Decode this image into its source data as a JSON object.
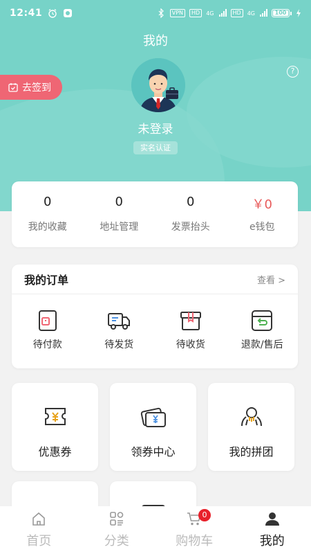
{
  "status_bar": {
    "time": "12:41",
    "vpn": "VPN",
    "hd1": "HD",
    "hd2": "HD",
    "network1": "4G",
    "network2": "4G",
    "battery": "100"
  },
  "header": {
    "title": "我的",
    "sign_in": "去签到",
    "login_status": "未登录",
    "verify": "实名认证",
    "help": "?"
  },
  "stats": [
    {
      "value": "0",
      "label": "我的收藏"
    },
    {
      "value": "0",
      "label": "地址管理"
    },
    {
      "value": "0",
      "label": "发票抬头"
    },
    {
      "value": "￥0",
      "label": "e钱包"
    }
  ],
  "orders": {
    "title": "我的订单",
    "more": "查看 >",
    "items": [
      {
        "label": "待付款",
        "icon": "wallet-icon"
      },
      {
        "label": "待发货",
        "icon": "truck-icon"
      },
      {
        "label": "待收货",
        "icon": "package-icon"
      },
      {
        "label": "退款/售后",
        "icon": "refund-icon"
      }
    ]
  },
  "tiles": [
    {
      "label": "优惠券",
      "icon": "coupon-icon"
    },
    {
      "label": "领券中心",
      "icon": "coupon-center-icon"
    },
    {
      "label": "我的拼团",
      "icon": "group-buy-icon"
    },
    {
      "label": "",
      "icon": "tile-icon"
    },
    {
      "label": "",
      "icon": "tile-icon"
    }
  ],
  "tabbar": {
    "items": [
      {
        "label": "首页",
        "icon": "home-icon"
      },
      {
        "label": "分类",
        "icon": "category-icon"
      },
      {
        "label": "购物车",
        "icon": "cart-icon"
      },
      {
        "label": "我的",
        "icon": "profile-icon"
      }
    ],
    "cart_badge": "0"
  },
  "colors": {
    "header_bg": "#77d3c8",
    "sign_in_bg": "#ef6674",
    "money": "#e85b5b",
    "badge": "#e8202a"
  }
}
